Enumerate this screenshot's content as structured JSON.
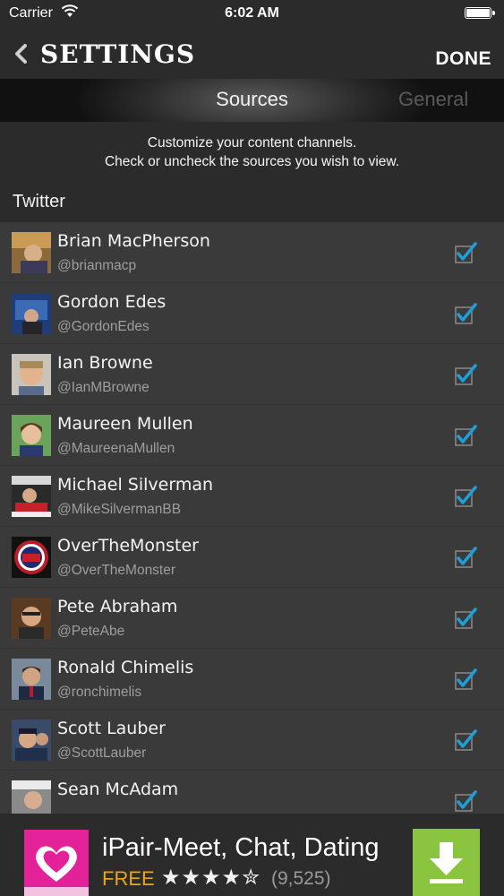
{
  "status_bar": {
    "carrier": "Carrier",
    "time": "6:02 AM"
  },
  "nav": {
    "back_icon": "chevron-left-icon",
    "title": "SETTINGS",
    "done_label": "DONE"
  },
  "tabs": [
    {
      "label": "Sources"
    },
    {
      "label": "General"
    }
  ],
  "intro": {
    "line1": "Customize your content channels.",
    "line2": "Check or uncheck the sources you wish to view."
  },
  "section": {
    "title": "Twitter"
  },
  "sources": [
    {
      "name": "Brian MacPherson",
      "handle": "@brianmacp",
      "checked": true
    },
    {
      "name": "Gordon Edes",
      "handle": "@GordonEdes",
      "checked": true
    },
    {
      "name": "Ian Browne",
      "handle": "@IanMBrowne",
      "checked": true
    },
    {
      "name": "Maureen Mullen",
      "handle": "@MaureenaMullen",
      "checked": true
    },
    {
      "name": "Michael Silverman",
      "handle": "@MikeSilvermanBB",
      "checked": true
    },
    {
      "name": "OverTheMonster",
      "handle": "@OverTheMonster",
      "checked": true
    },
    {
      "name": "Pete Abraham",
      "handle": "@PeteAbe",
      "checked": true
    },
    {
      "name": "Ronald Chimelis",
      "handle": "@ronchimelis",
      "checked": true
    },
    {
      "name": "Scott Lauber",
      "handle": "@ScottLauber",
      "checked": true
    },
    {
      "name": "Sean McAdam",
      "handle": "",
      "checked": true
    }
  ],
  "ad": {
    "title": "iPair-Meet, Chat, Dating",
    "price": "FREE",
    "stars": "★★★★✮",
    "rating_count": "(9,525)",
    "rating": 4.5,
    "download_icon": "download-arrow-icon"
  },
  "colors": {
    "accent_check": "#1e9fd8",
    "ad_brand": "#e3229a",
    "ad_download": "#8bc53f",
    "free_text": "#f0a21a"
  }
}
